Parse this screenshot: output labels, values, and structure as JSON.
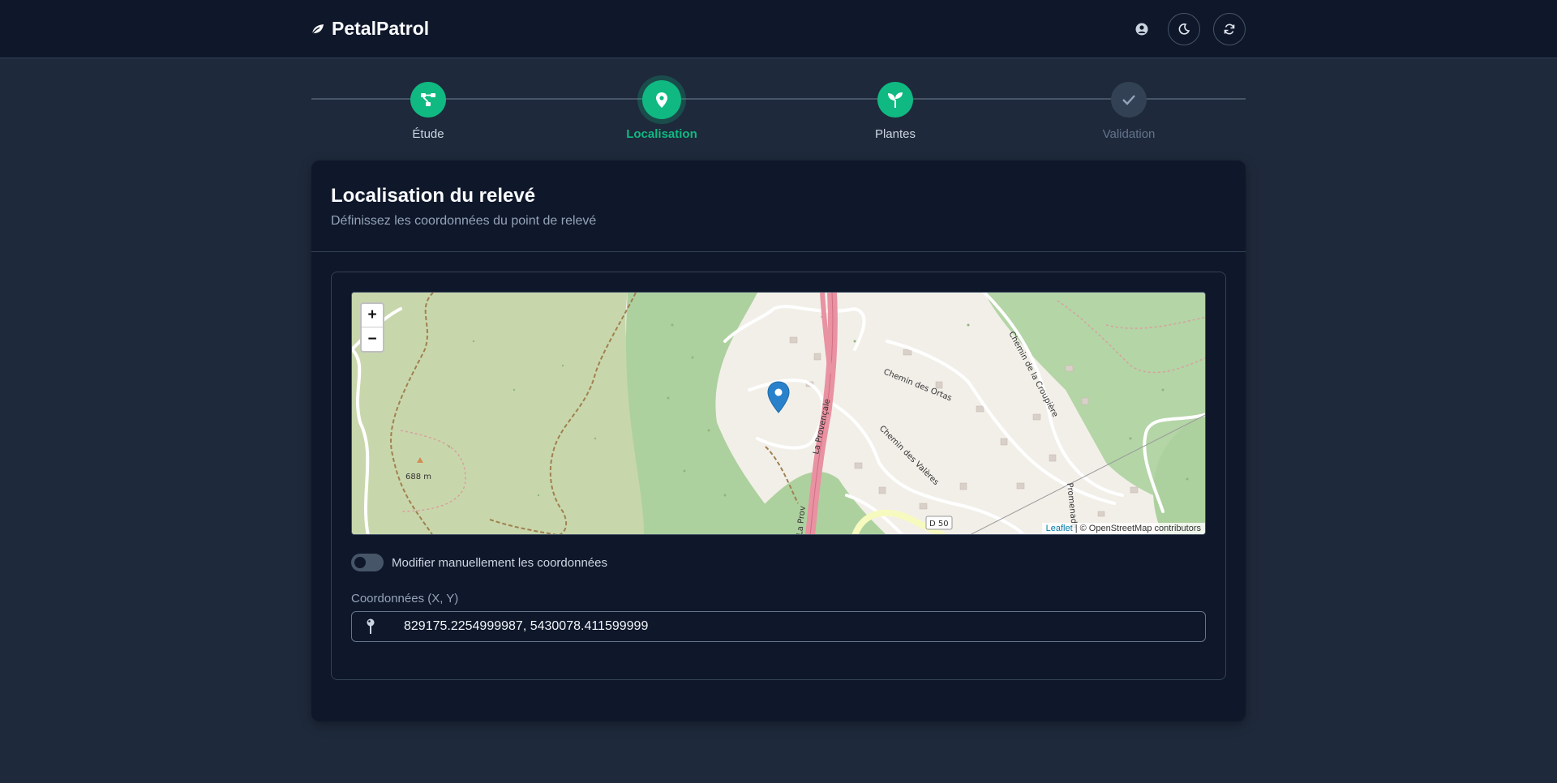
{
  "header": {
    "brand": "PetalPatrol",
    "icons": {
      "brand": "leaf-icon",
      "user": "user-circle-icon",
      "theme": "moon-icon",
      "refresh": "refresh-icon"
    }
  },
  "stepper": {
    "steps": [
      {
        "label": "Étude",
        "icon": "diagram-icon",
        "state": "done"
      },
      {
        "label": "Localisation",
        "icon": "map-pin-icon",
        "state": "active"
      },
      {
        "label": "Plantes",
        "icon": "seedling-icon",
        "state": "done"
      },
      {
        "label": "Validation",
        "icon": "check-icon",
        "state": "pending"
      }
    ],
    "colors": {
      "accent": "#10b981",
      "pending": "#334155"
    }
  },
  "card": {
    "title": "Localisation du relevé",
    "subtitle": "Définissez les coordonnées du point de relevé"
  },
  "map": {
    "zoom_in": "+",
    "zoom_out": "−",
    "attribution_link": "Leaflet",
    "attribution_text": " | © OpenStreetMap contributors",
    "labels": {
      "elevation": "688 m",
      "road_d50": "D 50",
      "chemin_ortas": "Chemin des Ortas",
      "chemin_valeres": "Chemin des Valères",
      "chemin_croupiere": "Chemin de la Croupière",
      "la_provencale": "La Provençale",
      "la_prov": "La Prov",
      "promenade": "Promenade"
    }
  },
  "toggle": {
    "label": "Modifier manuellement les coordonnées",
    "checked": false
  },
  "coordinates": {
    "label": "Coordonnées (X, Y)",
    "value": "829175.2254999987, 5430078.411599999",
    "icon": "pin-icon"
  }
}
